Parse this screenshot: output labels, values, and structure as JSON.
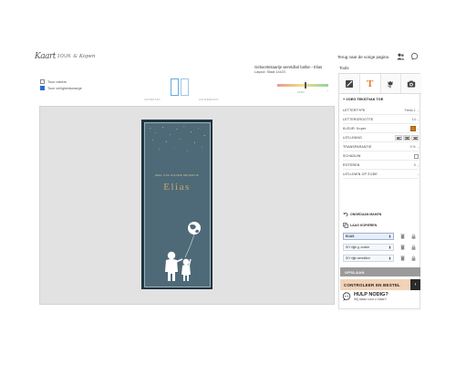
{
  "header": {
    "logo_script": "Kaart",
    "logo_word": "JOUK",
    "logo_word2": "& Kopen",
    "back_link": "Terug naar de vorige pagina",
    "icons": [
      "users-icon",
      "chat-icon"
    ]
  },
  "document": {
    "title": "Geboortekaartje wereldbol ballon - Elias",
    "subtitle": "Layout: Staat 14x23"
  },
  "tools_label": "Tools",
  "canvas_options": {
    "show_border": "Toon rasters",
    "show_safe_margin": "Toon veiligheidsmarge",
    "show_border_checked": false,
    "show_safe_margin_checked": true
  },
  "pages": {
    "front_label": "VOORKANT",
    "back_label": "ACHTERKANT"
  },
  "zoom": {
    "value_label": "134%",
    "level": 0.56,
    "min_label": "-",
    "max_label": "+"
  },
  "card": {
    "pre_text": "HEEL ONS NIEUWE BROERTJE",
    "name": "Elias",
    "background_color": "#4e6a78",
    "accent_color": "#c9a86a"
  },
  "panel": {
    "tabs": [
      {
        "name": "image-edit-tab",
        "icon": "image-edit-icon"
      },
      {
        "name": "text-tab",
        "label": "T"
      },
      {
        "name": "tulip-tab",
        "icon": "tulip-icon"
      },
      {
        "name": "camera-tab",
        "icon": "camera-icon"
      }
    ],
    "add_text": "+ VOEG TEKSTVAK TOE",
    "rows": [
      {
        "label": "LETTERTYPE",
        "value": "Fredo 1"
      },
      {
        "label": "LETTERGROOTTE",
        "value": "14"
      },
      {
        "label": "KLEUR: Koper",
        "value": ""
      },
      {
        "label": "UITLIJNING",
        "value": ""
      },
      {
        "label": "TRANSPARANTIE",
        "value": "0 %"
      },
      {
        "label": "SCHADUW",
        "value": ""
      },
      {
        "label": "ROTEREN",
        "value": "0"
      },
      {
        "label": "UITLIJNEN OP ZIJDE",
        "value": ""
      }
    ],
    "undo_label": "ONGEDAAN MAKEN",
    "copy_layer_label": "LAAG KOPIEREN",
    "layers": [
      {
        "label": "ELIAS"
      },
      {
        "label": "DIY rijtje g. zonder"
      },
      {
        "label": "DIY rijtje wereldbol"
      }
    ],
    "swatch_color": "#c77a18"
  },
  "buttons": {
    "save": "OPSLAAN",
    "order": "CONTROLEER EN BESTEL",
    "order_arrow": "›"
  },
  "help": {
    "title": "HULP NODIG?",
    "subtitle": "Wij staan voor u klaar!!"
  }
}
